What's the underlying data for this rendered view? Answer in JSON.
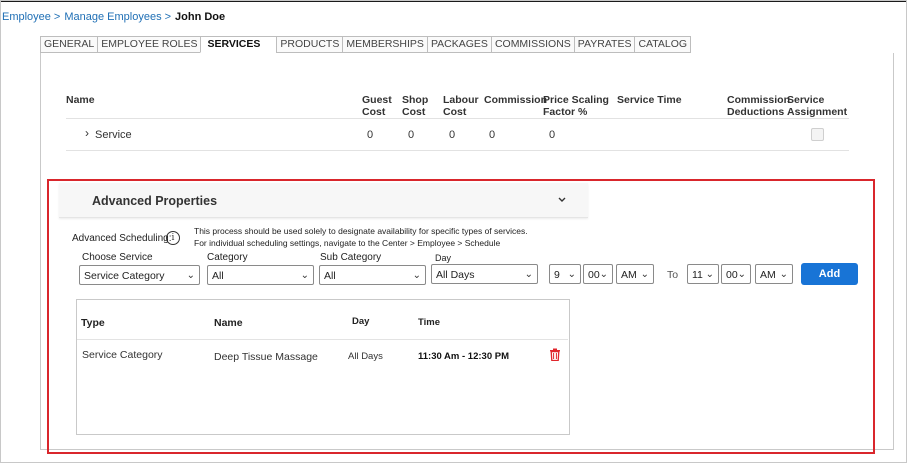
{
  "breadcrumb": {
    "items": [
      "Employee",
      "Manage Employees"
    ],
    "separator": ">",
    "current": "John Doe"
  },
  "tabs": [
    "GENERAL",
    "EMPLOYEE ROLES",
    "SERVICES",
    "PRODUCTS",
    "MEMBERSHIPS",
    "PACKAGES",
    "COMMISSIONS",
    "PAYRATES",
    "CATALOG"
  ],
  "active_tab": "SERVICES",
  "services_grid": {
    "headers": {
      "name": "Name",
      "guest_cost": [
        "Guest",
        "Cost"
      ],
      "shop_cost": [
        "Shop",
        "Cost"
      ],
      "labour_cost": [
        "Labour",
        "Cost"
      ],
      "commission": "Commission",
      "price_scaling": [
        "Price Scaling",
        "Factor %"
      ],
      "service_time": "Service Time",
      "commission_deductions": [
        "Commission",
        "Deductions"
      ],
      "service_assignment": [
        "Service",
        "Assignment"
      ]
    },
    "row": {
      "expander": "›",
      "name": "Service",
      "guest_cost": "0",
      "shop_cost": "0",
      "labour_cost": "0",
      "commission": "0",
      "price_scaling": "0"
    }
  },
  "advanced": {
    "title": "Advanced Properties",
    "scheduling_label": "Advanced Scheduling:",
    "info_glyph": "i",
    "note_line1": "This process should be used solely to designate availability for specific types of services.",
    "note_line2": "For individual scheduling settings, navigate to the Center > Employee > Schedule",
    "labels": {
      "choose_service": "Choose Service",
      "category": "Category",
      "sub_category": "Sub Category",
      "day": "Day",
      "to": "To"
    },
    "selects": {
      "choose_service": "Service Category",
      "category": "All",
      "sub_category": "All",
      "day": "All Days",
      "from_hour": "9",
      "from_minute": "00",
      "from_ampm": "AM",
      "to_hour": "11",
      "to_minute": "00",
      "to_ampm": "AM"
    },
    "add_label": "Add",
    "table": {
      "headers": [
        "Type",
        "Name",
        "Day",
        "Time"
      ],
      "rows": [
        {
          "type": "Service Category",
          "name": "Deep Tissue Massage",
          "day": "All Days",
          "time": "11:30 Am - 12:30 PM"
        }
      ]
    }
  },
  "colors": {
    "link": "#1f6fb5",
    "highlight_border": "#d9262c",
    "primary_button": "#1874d6",
    "delete_icon": "#e0262c"
  },
  "icons": {
    "expand": "chevron-right-icon",
    "collapse": "chevron-down-icon",
    "info": "info-icon",
    "delete": "trash-icon"
  }
}
